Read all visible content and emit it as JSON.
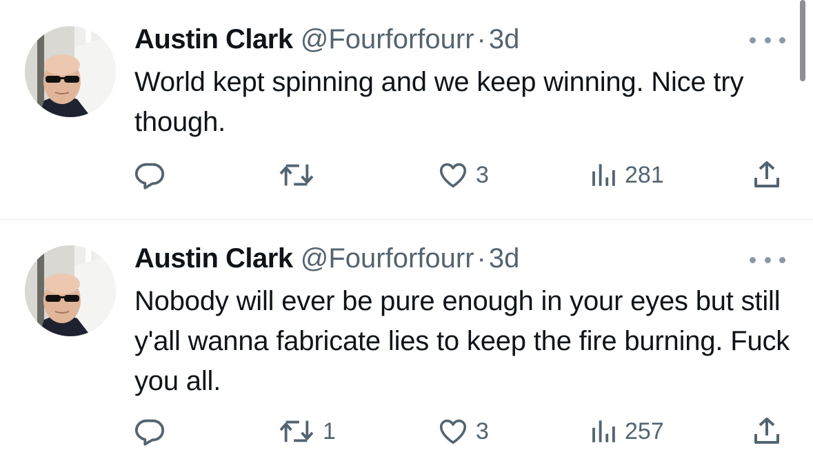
{
  "tweets": [
    {
      "author_name": "Austin Clark",
      "handle": "@Fourforfourr",
      "separator": "·",
      "time": "3d",
      "text": "World kept spinning and we keep winning. Nice try though.",
      "retweets": "",
      "likes": "3",
      "views": "281"
    },
    {
      "author_name": "Austin Clark",
      "handle": "@Fourforfourr",
      "separator": "·",
      "time": "3d",
      "text": "Nobody will ever be pure enough in your eyes but still y'all wanna fabricate lies to keep the fire burning. Fuck you all.",
      "retweets": "1",
      "likes": "3",
      "views": "257"
    }
  ],
  "icons": {
    "reply": "reply-icon",
    "retweet": "retweet-icon",
    "like": "heart-icon",
    "views": "views-icon",
    "share": "share-icon",
    "more": "more-icon"
  },
  "colors": {
    "text": "#0f1419",
    "secondary": "#536471",
    "divider": "#eff3f4"
  }
}
